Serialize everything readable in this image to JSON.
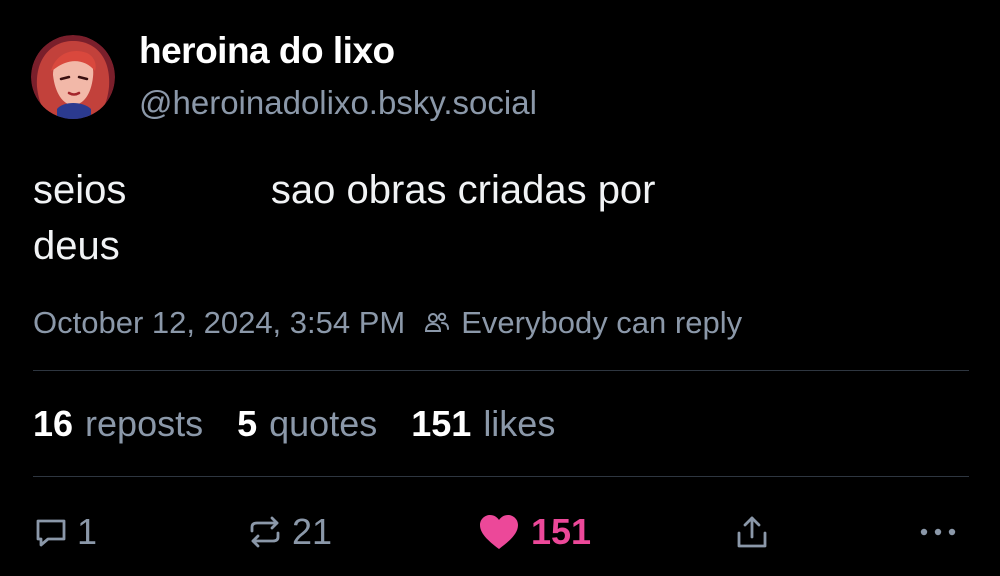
{
  "author": {
    "display_name": "heroina do lixo",
    "handle": "@heroinadolixo.bsky.social"
  },
  "post": {
    "text_line_1": "seios             sao obras criadas por",
    "text_line_2": "deus"
  },
  "meta": {
    "timestamp": "October 12, 2024, 3:54 PM",
    "reply_setting": "Everybody can reply"
  },
  "stats": {
    "reposts_count": "16",
    "reposts_label": "reposts",
    "quotes_count": "5",
    "quotes_label": "quotes",
    "likes_count": "151",
    "likes_label": "likes"
  },
  "actions": {
    "reply_count": "1",
    "repost_count": "21",
    "like_count": "151"
  },
  "colors": {
    "background": "#000000",
    "muted_text": "#8b98a9",
    "like_pink": "#ec4899",
    "divider": "#2e3640"
  },
  "icons": {
    "reply": "speech-bubble-icon",
    "repost": "repost-arrows-icon",
    "like": "heart-icon",
    "share": "share-icon",
    "more": "more-dots-icon",
    "reply_setting": "people-icon"
  }
}
